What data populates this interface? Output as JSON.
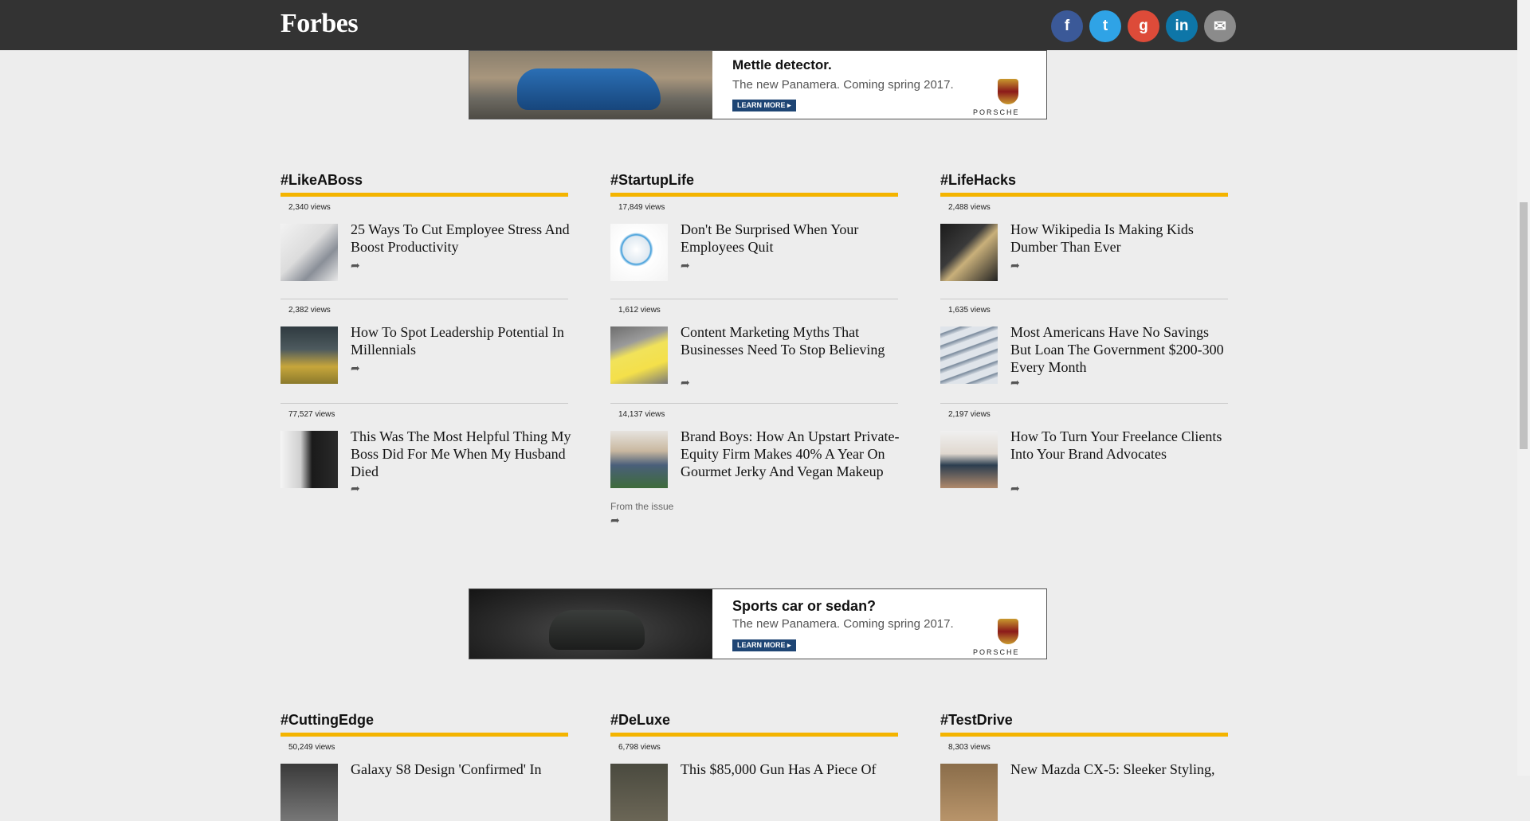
{
  "header": {
    "logo": "Forbes",
    "social": [
      {
        "name": "facebook-icon",
        "glyph": "f",
        "color": "#3b5998"
      },
      {
        "name": "twitter-icon",
        "glyph": "t",
        "color": "#2fa3e6"
      },
      {
        "name": "google-plus-icon",
        "glyph": "g",
        "color": "#dd4b39"
      },
      {
        "name": "linkedin-icon",
        "glyph": "in",
        "color": "#0e76a8"
      },
      {
        "name": "email-icon",
        "glyph": "✉",
        "color": "#8b8b8b"
      }
    ]
  },
  "ads": [
    {
      "headline": "Mettle detector.",
      "subline": "The new Panamera. Coming spring 2017.",
      "button": "LEARN MORE ▸",
      "brand": "PORSCHE"
    },
    {
      "headline": "Sports car or sedan?",
      "subline": "The new Panamera. Coming spring 2017.",
      "button": "LEARN MORE ▸",
      "brand": "PORSCHE"
    }
  ],
  "accent_color": "#f4b400",
  "sections": [
    {
      "title": "#LikeABoss",
      "articles": [
        {
          "views": "2,340 views",
          "headline": "25 Ways To Cut Employee Stress And Boost Productivity"
        },
        {
          "views": "2,382 views",
          "headline": "How To Spot Leadership Potential In Millennials"
        },
        {
          "views": "77,527 views",
          "headline": "This Was The Most Helpful Thing My Boss Did For Me When My Husband Died"
        }
      ]
    },
    {
      "title": "#StartupLife",
      "articles": [
        {
          "views": "17,849 views",
          "headline": "Don't Be Surprised When Your Employees Quit"
        },
        {
          "views": "1,612 views",
          "headline": "Content Marketing Myths That Businesses Need To Stop Believing"
        },
        {
          "views": "14,137 views",
          "headline": "Brand Boys: How An Upstart Private-Equity Firm Makes 40% A Year On Gourmet Jerky And Vegan Makeup",
          "note": "From the issue"
        }
      ]
    },
    {
      "title": "#LifeHacks",
      "articles": [
        {
          "views": "2,488 views",
          "headline": "How Wikipedia Is Making Kids Dumber Than Ever"
        },
        {
          "views": "1,635 views",
          "headline": "Most Americans Have No Savings But Loan The Government $200-300 Every Month"
        },
        {
          "views": "2,197 views",
          "headline": "How To Turn Your Freelance Clients Into Your Brand Advocates"
        }
      ]
    },
    {
      "title": "#CuttingEdge",
      "articles": [
        {
          "views": "50,249 views",
          "headline": "Galaxy S8 Design 'Confirmed' In"
        }
      ]
    },
    {
      "title": "#DeLuxe",
      "articles": [
        {
          "views": "6,798 views",
          "headline": "This $85,000 Gun Has A Piece Of"
        }
      ]
    },
    {
      "title": "#TestDrive",
      "articles": [
        {
          "views": "8,303 views",
          "headline": "New Mazda CX-5: Sleeker Styling,"
        }
      ]
    }
  ],
  "share_glyph": "➦"
}
